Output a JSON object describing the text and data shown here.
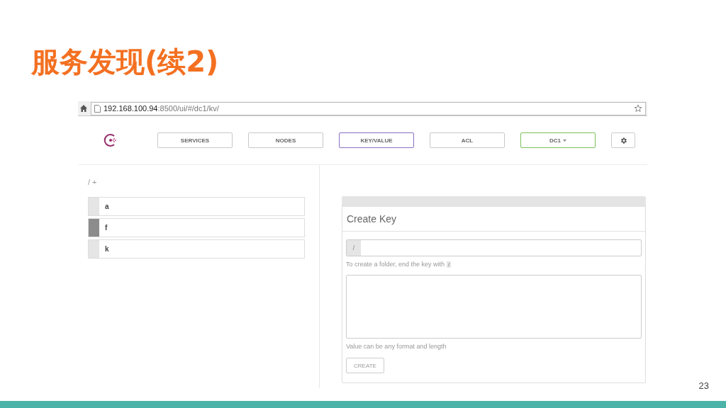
{
  "slide": {
    "title": "服务发现(续2)",
    "page_number": "23"
  },
  "browser": {
    "url_host": "192.168.100.94",
    "url_path": ":8500/ui/#/dc1/kv/"
  },
  "nav": [
    {
      "label": "SERVICES",
      "kind": "tab",
      "selected": false
    },
    {
      "label": "NODES",
      "kind": "tab",
      "selected": false
    },
    {
      "label": "KEY/VALUE",
      "kind": "tab",
      "selected": true
    },
    {
      "label": "ACL",
      "kind": "tab",
      "selected": false
    },
    {
      "label": "DC1",
      "kind": "dropdown"
    }
  ],
  "breadcrumb": {
    "path": "/",
    "add": "+"
  },
  "keys": [
    {
      "name": "a",
      "selected": false
    },
    {
      "name": "f",
      "selected": true
    },
    {
      "name": "k",
      "selected": false
    }
  ],
  "create_panel": {
    "title": "Create Key",
    "key_prefix": "/",
    "key_hint": "To create a folder, end the key with",
    "key_hint_code": "/",
    "value_hint": "Value can be any format and length",
    "button": "CREATE"
  }
}
